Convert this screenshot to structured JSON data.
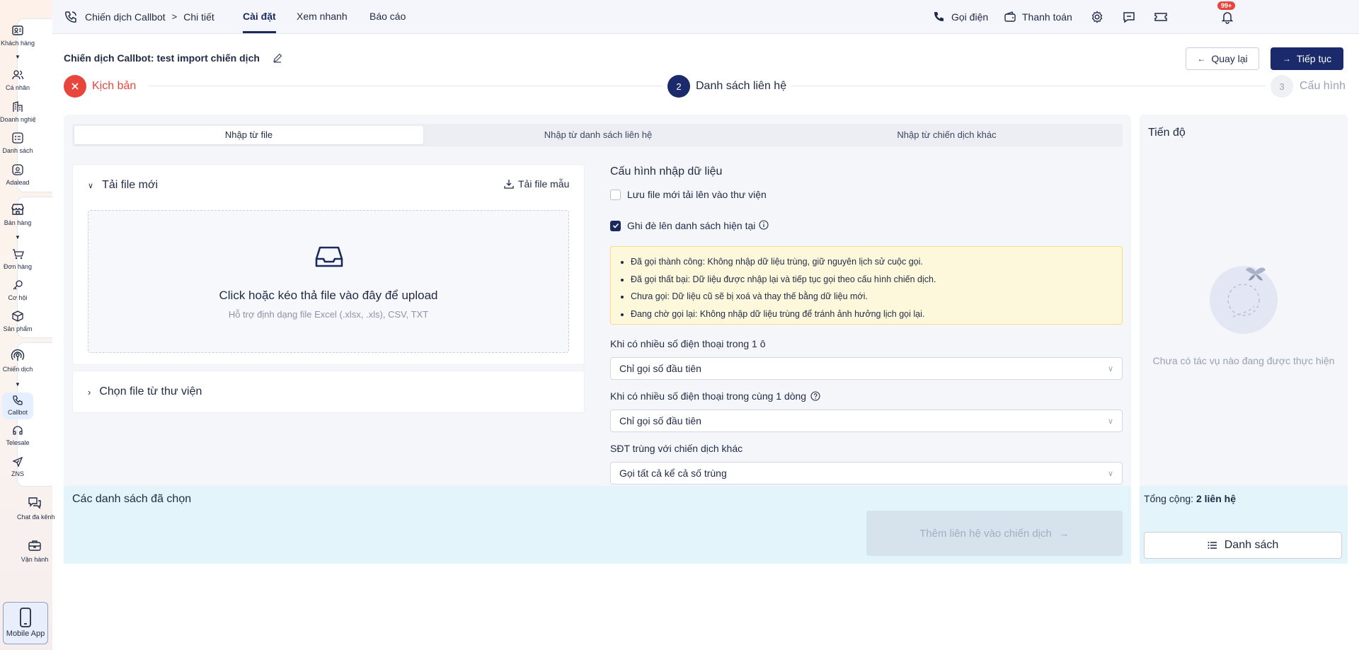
{
  "sidebar": {
    "groups": [
      {
        "items": [
          {
            "label": "Khách hàng",
            "icon": "contact-card-icon",
            "caret": true
          },
          {
            "label": "Cá nhân",
            "icon": "users-icon"
          },
          {
            "label": "Doanh nghiệp",
            "icon": "building-icon"
          },
          {
            "label": "Danh sách",
            "icon": "list-icon"
          },
          {
            "label": "Adalead",
            "icon": "adalead-icon"
          }
        ]
      },
      {
        "items": [
          {
            "label": "Bán hàng",
            "icon": "store-icon",
            "caret": true
          },
          {
            "label": "Đơn hàng",
            "icon": "cart-icon"
          },
          {
            "label": "Cơ hội",
            "icon": "key-icon"
          },
          {
            "label": "Sản phẩm",
            "icon": "box-icon"
          }
        ]
      },
      {
        "items": [
          {
            "label": "Chiến dịch",
            "icon": "broadcast-icon",
            "caret": true
          },
          {
            "label": "Callbot",
            "icon": "phone-icon",
            "active": true
          },
          {
            "label": "Telesale",
            "icon": "headset-icon"
          },
          {
            "label": "ZNS",
            "icon": "send-icon"
          }
        ]
      }
    ],
    "chat_label": "Chat đa kênh",
    "ops_label": "Vận hành",
    "mobile_app_label": "Mobile App"
  },
  "topnav": {
    "breadcrumb_1": "Chiến dịch Callbot",
    "breadcrumb_2": "Chi tiết",
    "tab_settings": "Cài đặt",
    "tab_preview": "Xem nhanh",
    "tab_report": "Báo cáo",
    "call_label": "Gọi điện",
    "payment_label": "Thanh toán",
    "notification_count": "99+"
  },
  "header": {
    "title": "Chiến dịch Callbot: test import chiến dịch",
    "back_label": "Quay lại",
    "next_label": "Tiếp tục"
  },
  "stepper": {
    "step1_label": "Kịch bản",
    "step2_number": "2",
    "step2_label": "Danh sách liên hệ",
    "step3_number": "3",
    "step3_label": "Cấu hình"
  },
  "import_tabs": {
    "tab_file": "Nhập từ file",
    "tab_contact_list": "Nhập từ danh sách liên hệ",
    "tab_other_campaign": "Nhập từ chiến dịch khác"
  },
  "upload": {
    "panel_title": "Tải file mới",
    "template_label": "Tải file mẫu",
    "drop_title": "Click hoặc kéo thả file vào đây để upload",
    "drop_hint": "Hỗ trợ định dạng file Excel (.xlsx, .xls), CSV, TXT",
    "library_title": "Chọn file từ thư viện"
  },
  "config": {
    "title": "Cấu hình nhập dữ liệu",
    "save_to_library": "Lưu file mới tải lên vào thư viện",
    "save_to_library_checked": false,
    "overwrite": "Ghi đè lên danh sách hiện tại",
    "overwrite_checked": true,
    "notes": [
      "Đã gọi thành công: Không nhập dữ liệu trùng, giữ nguyên lịch sử cuộc gọi.",
      "Đã gọi thất bại: Dữ liệu được nhập lại và tiếp tục gọi theo cấu hình chiến dịch.",
      "Chưa gọi: Dữ liệu cũ sẽ bị xoá và thay thế bằng dữ liệu mới.",
      "Đang chờ gọi lại: Không nhập dữ liệu trùng để tránh ảnh hưởng lịch gọi lại."
    ],
    "field1_label": "Khi có nhiều số điện thoại trong 1 ô",
    "field1_value": "Chỉ gọi số đầu tiên",
    "field2_label": "Khi có nhiều số điện thoại trong cùng 1 dòng",
    "field2_value": "Chỉ gọi số đầu tiên",
    "field3_label": "SĐT trùng với chiến dịch khác",
    "field3_value": "Gọi tất cả kể cả số trùng"
  },
  "selected": {
    "title": "Các danh sách đã chọn",
    "add_button": "Thêm liên hệ vào chiến dịch"
  },
  "progress": {
    "title": "Tiến độ",
    "empty_text": "Chưa có tác vụ nào đang được thực hiện",
    "total_label": "Tổng cộng:",
    "total_value": "2 liên hệ",
    "list_button": "Danh sách"
  },
  "colors": {
    "primary": "#1b2a6b",
    "error": "#e8453c",
    "notice_bg": "#fdf8dc",
    "selected_bg": "#e3f4fb"
  }
}
